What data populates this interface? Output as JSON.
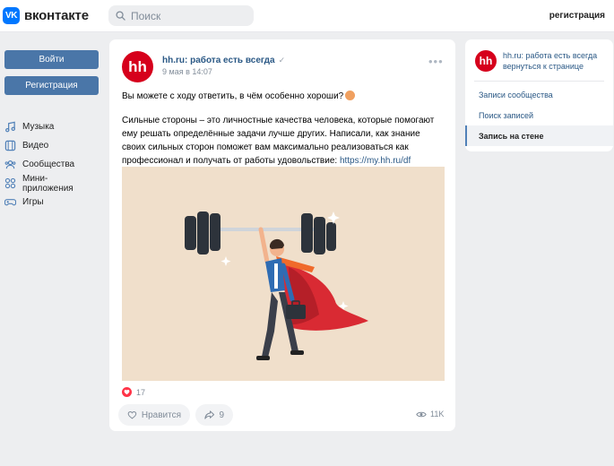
{
  "header": {
    "logo_letters": "VK",
    "logo_text": "вконтакте",
    "search_placeholder": "Поиск",
    "register_link": "регистрация"
  },
  "left": {
    "login_label": "Войти",
    "register_label": "Регистрация",
    "menu": [
      {
        "label": "Музыка",
        "icon": "music-icon"
      },
      {
        "label": "Видео",
        "icon": "video-icon"
      },
      {
        "label": "Сообщества",
        "icon": "communities-icon"
      },
      {
        "label": "Мини-приложения",
        "icon": "apps-icon"
      },
      {
        "label": "Игры",
        "icon": "games-icon"
      }
    ]
  },
  "post": {
    "avatar_text": "hh",
    "author": "hh.ru: работа есть всегда",
    "verified": "✓",
    "date": "9 мая в 14:07",
    "more": "•••",
    "text1": "Вы можете с ходу ответить, в чём особенно хороши?",
    "text2": "Сильные стороны – это личностные качества человека, которые помогают ему решать определённые задачи лучше других. Написали, как знание своих сильных сторон поможет вам максимально реализоваться как профессионал и получать от работы удовольствие:",
    "link": "https://my.hh.ru/df",
    "reactions_count": "17",
    "like_label": "Нравится",
    "share_count": "9",
    "views": "11K"
  },
  "right": {
    "avatar_text": "hh",
    "header_text": "hh.ru: работа есть всегда вернуться к странице",
    "items": [
      "Записи сообщества",
      "Поиск записей",
      "Запись на стене"
    ]
  },
  "colors": {
    "brand": "#0077ff",
    "button": "#4a76a8",
    "link": "#2a5885",
    "hh_red": "#d6001c",
    "image_bg": "#f0dfcb"
  }
}
